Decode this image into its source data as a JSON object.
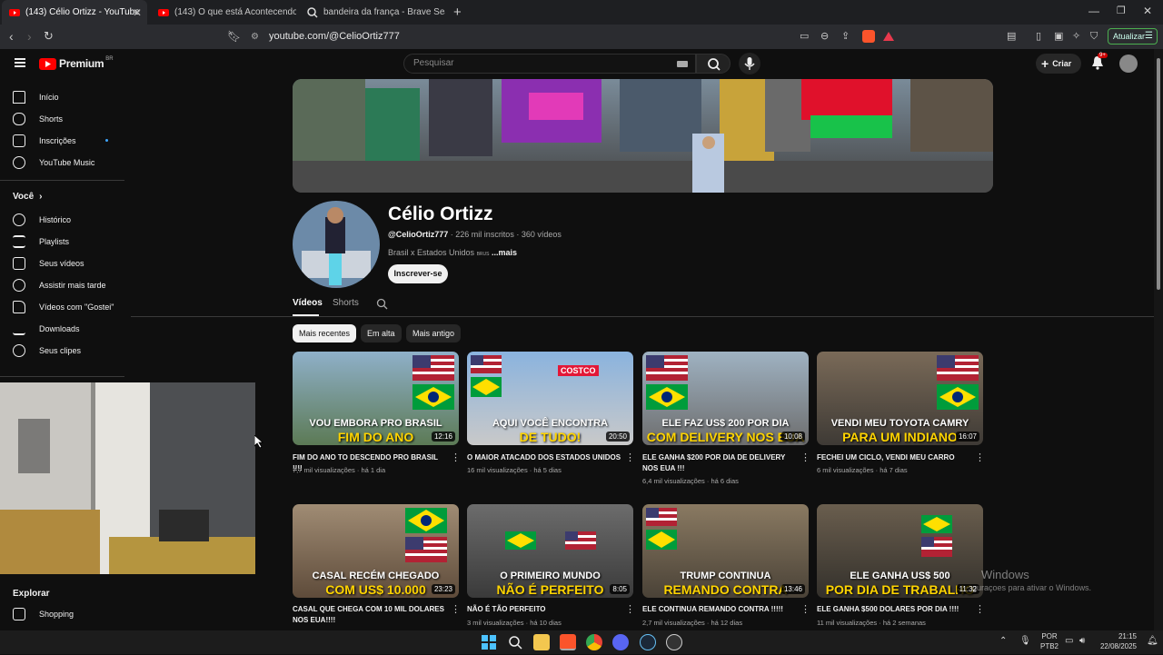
{
  "browser": {
    "tabs": [
      {
        "title": "(143) Célio Ortizz - YouTube",
        "active": true
      },
      {
        "title": "(143) O que está Acontecendo com o",
        "active": false
      },
      {
        "title": "bandeira da frança - Brave Search",
        "active": false
      }
    ],
    "url": "youtube.com/@CelioOrtiz777",
    "update_label": "Atualizar"
  },
  "header": {
    "logo_text": "Premium",
    "region": "BR",
    "search_placeholder": "Pesquisar",
    "create_label": "Criar",
    "notif_badge": "9+"
  },
  "sidebar": {
    "primary": [
      {
        "label": "Início"
      },
      {
        "label": "Shorts"
      },
      {
        "label": "Inscrições"
      },
      {
        "label": "YouTube Music"
      }
    ],
    "you_heading": "Você",
    "you_items": [
      {
        "label": "Histórico"
      },
      {
        "label": "Playlists"
      },
      {
        "label": "Seus vídeos"
      },
      {
        "label": "Assistir mais tarde"
      },
      {
        "label": "Vídeos com \"Gostei\""
      },
      {
        "label": "Downloads"
      },
      {
        "label": "Seus clipes"
      }
    ],
    "explore_heading": "Explorar",
    "explore_items": [
      {
        "label": "Shopping"
      }
    ]
  },
  "channel": {
    "name": "Célio Ortizz",
    "handle": "@CelioOrtiz777",
    "meta": " · 226 mil inscritos · 360 vídeos",
    "description": "Brasil x Estados Unidos",
    "desc_flags": "BRUS",
    "more": "...mais",
    "subscribe_label": "Inscrever-se",
    "tabs": [
      {
        "label": "Vídeos"
      },
      {
        "label": "Shorts"
      }
    ]
  },
  "chips": [
    {
      "label": "Mais recentes",
      "selected": true
    },
    {
      "label": "Em alta",
      "selected": false
    },
    {
      "label": "Mais antigo",
      "selected": false
    }
  ],
  "videos": [
    {
      "title": "FIM DO ANO TO DESCENDO PRO BRASIL !!!!",
      "views": "7,7 mil visualizações",
      "age": "há 1 dia",
      "duration": "12:16",
      "cap1": "VOU EMBORA PRO BRASIL",
      "cap2": "FIM DO ANO"
    },
    {
      "title": "O MAIOR ATACADO DOS ESTADOS UNIDOS",
      "views": "16 mil visualizações",
      "age": "há 5 dias",
      "duration": "20:50",
      "cap1": "AQUI VOCÊ ENCONTRA",
      "cap2": "DE TUDO!"
    },
    {
      "title": "ELE GANHA $200 POR DIA DE DELIVERY NOS EUA !!!",
      "views": "6,4 mil visualizações",
      "age": "há 6 dias",
      "duration": "10:08",
      "cap1": "ELE FAZ US$ 200 POR DIA",
      "cap2": "COM DELIVERY NOS EUA"
    },
    {
      "title": "FECHEI UM CICLO, VENDI MEU CARRO",
      "views": "6 mil visualizações",
      "age": "há 7 dias",
      "duration": "16:07",
      "cap1": "VENDI MEU TOYOTA CAMRY",
      "cap2": "PARA UM INDIANO"
    },
    {
      "title": "CASAL QUE CHEGA COM 10 MIL DOLARES NOS EUA!!!!",
      "views": "",
      "age": "",
      "duration": "23:23",
      "cap1": "CASAL RECÉM CHEGADO",
      "cap2": "COM US$ 10.000"
    },
    {
      "title": "NÃO É TÃO PERFEITO",
      "views": "3 mil visualizações",
      "age": "há 10 dias",
      "duration": "8:05",
      "cap1": "O PRIMEIRO MUNDO",
      "cap2": "NÃO É PERFEITO"
    },
    {
      "title": "ELE CONTINUA REMANDO CONTRA !!!!!",
      "views": "2,7 mil visualizações",
      "age": "há 12 dias",
      "duration": "13:46",
      "cap1": "TRUMP CONTINUA",
      "cap2": "REMANDO CONTRA"
    },
    {
      "title": "ELE GANHA $500 DOLARES POR DIA !!!!",
      "views": "11 mil visualizações",
      "age": "há 2 semanas",
      "duration": "11:32",
      "cap1": "ELE GANHA US$ 500",
      "cap2": "POR DIA DE TRABALHO"
    }
  ],
  "windows": {
    "watermark_title": "Windows",
    "watermark_sub": "guraçoes para ativar o Windows.",
    "lang_top": "POR",
    "lang_bottom": "PTB2",
    "time": "21:15",
    "date": "22/08/2025"
  }
}
